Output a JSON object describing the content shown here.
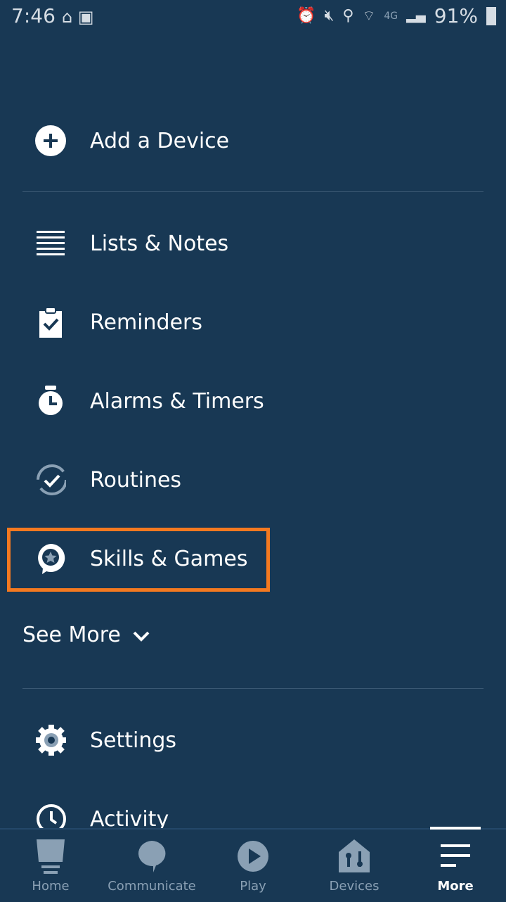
{
  "status_bar": {
    "time": "7:46",
    "battery": "91%",
    "network": "4G"
  },
  "menu": {
    "add_device": "Add a Device",
    "items": [
      {
        "label": "Lists & Notes",
        "icon": "list-icon"
      },
      {
        "label": "Reminders",
        "icon": "clipboard-check-icon"
      },
      {
        "label": "Alarms & Timers",
        "icon": "alarm-clock-icon"
      },
      {
        "label": "Routines",
        "icon": "routine-cycle-icon"
      },
      {
        "label": "Skills & Games",
        "icon": "skills-star-bubble-icon"
      }
    ],
    "see_more": "See More",
    "settings": "Settings",
    "activity": "Activity"
  },
  "highlight_color": "#f47920",
  "nav": {
    "tabs": [
      {
        "label": "Home"
      },
      {
        "label": "Communicate"
      },
      {
        "label": "Play"
      },
      {
        "label": "Devices"
      },
      {
        "label": "More",
        "active": true
      }
    ]
  }
}
